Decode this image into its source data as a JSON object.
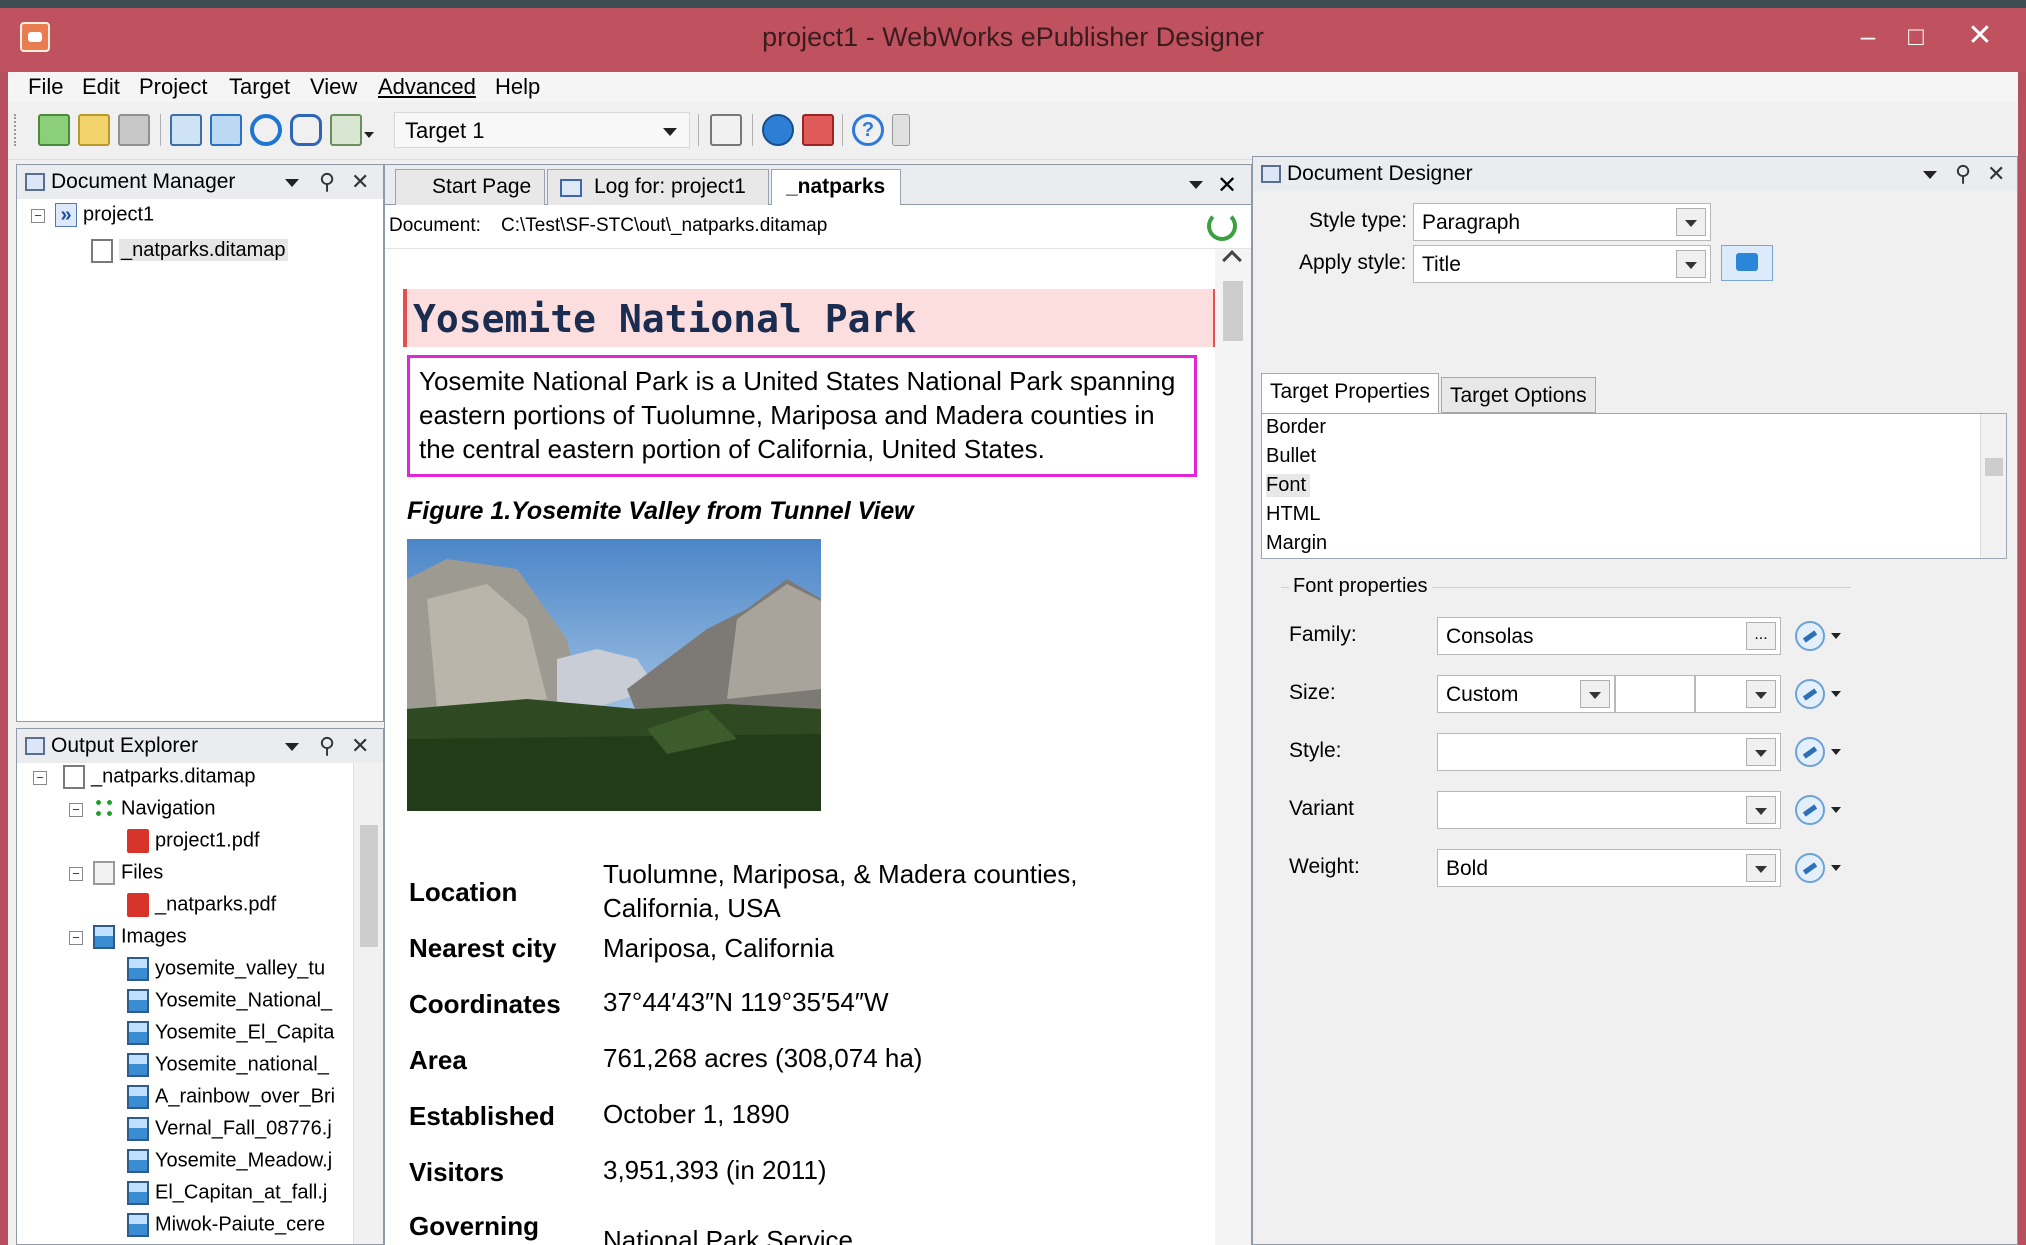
{
  "window": {
    "title": "project1 - WebWorks ePublisher Designer"
  },
  "menu": [
    "File",
    "Edit",
    "Project",
    "Target",
    "View",
    "Advanced",
    "Help"
  ],
  "toolbar": {
    "target_value": "Target 1"
  },
  "document_manager": {
    "title": "Document Manager",
    "tree": [
      {
        "label": "project1"
      },
      {
        "label": "_natparks.ditamap"
      }
    ]
  },
  "output_explorer": {
    "title": "Output Explorer",
    "tree": [
      {
        "label": "_natparks.ditamap",
        "icon": "document-icon"
      },
      {
        "label": "Navigation",
        "icon": "navigation-icon"
      },
      {
        "label": "project1.pdf",
        "icon": "pdf-icon"
      },
      {
        "label": "Files",
        "icon": "files-icon"
      },
      {
        "label": "_natparks.pdf",
        "icon": "pdf-icon"
      },
      {
        "label": "Images",
        "icon": "images-folder-icon"
      },
      {
        "label": "yosemite_valley_tu",
        "icon": "image-icon"
      },
      {
        "label": "Yosemite_National_",
        "icon": "image-icon"
      },
      {
        "label": "Yosemite_El_Capita",
        "icon": "image-icon"
      },
      {
        "label": "Yosemite_national_",
        "icon": "image-icon"
      },
      {
        "label": "A_rainbow_over_Bri",
        "icon": "image-icon"
      },
      {
        "label": "Vernal_Fall_08776.j",
        "icon": "image-icon"
      },
      {
        "label": "Yosemite_Meadow.j",
        "icon": "image-icon"
      },
      {
        "label": "El_Capitan_at_fall.j",
        "icon": "image-icon"
      },
      {
        "label": "Miwok-Paiute_cere",
        "icon": "image-icon"
      }
    ]
  },
  "editor": {
    "tabs": [
      "Start Page",
      "Log for: project1",
      "_natparks"
    ],
    "document_label": "Document:",
    "document_path": "C:\\Test\\SF-STC\\out\\_natparks.ditamap",
    "title": "Yosemite National Park",
    "intro": "Yosemite National Park is a United States National Park spanning eastern portions of Tuolumne, Mariposa and Madera counties in the central eastern portion of California, United States.",
    "figure_caption": "Figure 1.Yosemite Valley from Tunnel View",
    "facts": [
      {
        "label": "Location",
        "value": "Tuolumne, Mariposa, & Madera counties, California, USA"
      },
      {
        "label": "Nearest city",
        "value": "Mariposa, California"
      },
      {
        "label": "Coordinates",
        "value": "37°44′43″N 119°35′54″W"
      },
      {
        "label": "Area",
        "value": "761,268 acres (308,074 ha)"
      },
      {
        "label": "Established",
        "value": "October 1, 1890"
      },
      {
        "label": "Visitors",
        "value": "3,951,393 (in 2011)"
      },
      {
        "label": "Governing",
        "value": "National Park Service"
      }
    ]
  },
  "designer": {
    "title": "Document Designer",
    "style_type_label": "Style type:",
    "style_type_value": "Paragraph",
    "apply_style_label": "Apply style:",
    "apply_style_value": "Title",
    "tabs": [
      "Target Properties",
      "Target Options"
    ],
    "properties": [
      "Border",
      "Bullet",
      "Font",
      "HTML",
      "Margin"
    ],
    "selected_property": "Font",
    "group_label": "Font properties",
    "fields": [
      {
        "label": "Family:",
        "value": "Consolas"
      },
      {
        "label": "Size:",
        "value": "Custom"
      },
      {
        "label": "Style:",
        "value": ""
      },
      {
        "label": "Variant",
        "value": ""
      },
      {
        "label": "Weight:",
        "value": "Bold"
      }
    ]
  },
  "colors": {
    "titlebar": "#c0525f",
    "title_highlight": "#fcdede",
    "intro_border": "#e026d8",
    "heading_text": "#1a2c4f"
  }
}
